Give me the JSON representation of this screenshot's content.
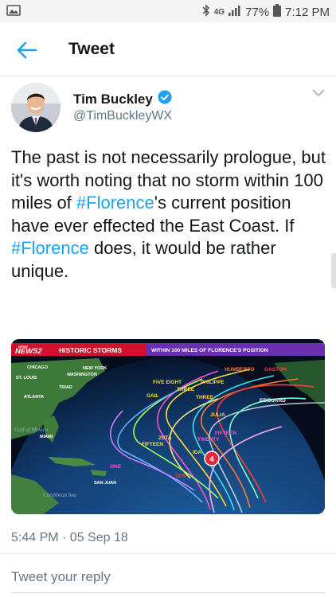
{
  "status_bar": {
    "left_icon": "gallery-notification-icon",
    "icons": [
      "bluetooth-icon",
      "lte-icon",
      "signal-icon",
      "battery-icon"
    ],
    "network": "4G",
    "battery": "77%",
    "time": "7:12 PM"
  },
  "app_bar": {
    "back_icon": "back-arrow-icon",
    "title": "Tweet"
  },
  "tweet": {
    "author_name": "Tim Buckley",
    "verified_icon": "verified-badge-icon",
    "handle": "@TimBuckleyWX",
    "text_parts": {
      "p1": "The past is not necessarily prologue, but it's worth noting that no storm within 100 miles of ",
      "h1": "#Florence",
      "p2": "'s current position have ever effected the East Coast. If ",
      "h2": "#Florence",
      "p3": " does, it would be rather unique."
    },
    "timestamp": "5:44 PM · 05 Sep 18"
  },
  "media": {
    "banner_logo": "NEWS2",
    "banner_logo_prefix": "WFMY",
    "banner_title": "HISTORIC STORMS",
    "banner_subtitle": "WITHIN 100 MILES OF FLORENCE'S POSITION",
    "cities": [
      "CHICAGO",
      "NEW YORK",
      "WASHINGTON",
      "ST. LOUIS",
      "TRIAD",
      "ATLANTA",
      "MIAMI",
      "SAN JUAN"
    ],
    "sea_labels": [
      "Gulf of Mexico",
      "Caribbean Sea"
    ],
    "storm_labels": [
      "HUMBERTO",
      "GASTON",
      "FIVE EIGHT",
      "PHILIPPE",
      "THREE",
      "GAIL",
      "THREE",
      "EDOUARD",
      "JULIA",
      "ZETA",
      "FIFTEEN",
      "FIFTEEN",
      "TWENTY",
      "IDA",
      "ONE",
      "TEN"
    ],
    "storm_marker": "4"
  },
  "reply": {
    "placeholder": "Tweet your reply"
  },
  "colors": {
    "accent": "#1da1f2",
    "text": "#14171a",
    "muted": "#657786",
    "banner_red": "#d0112b",
    "banner_purple": "#6a2fb0"
  }
}
